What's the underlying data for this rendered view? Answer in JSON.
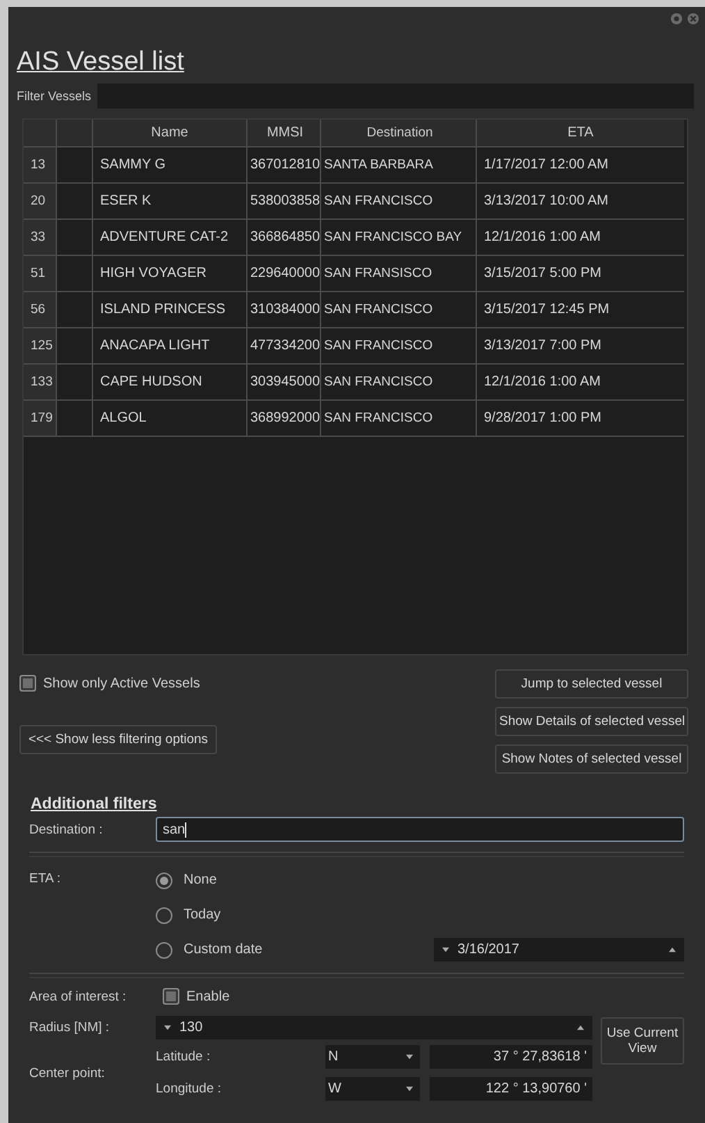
{
  "window": {
    "title": "AIS Vessel list"
  },
  "filter": {
    "label": "Filter Vessels"
  },
  "table": {
    "columns": [
      "Name",
      "MMSI",
      "Destination",
      "ETA"
    ],
    "rows": [
      {
        "number": "13",
        "name": "SAMMY G",
        "mmsi": "367012810",
        "destination": "SANTA BARBARA",
        "eta": "1/17/2017 12:00 AM"
      },
      {
        "number": "20",
        "name": "ESER K",
        "mmsi": "538003858",
        "destination": "SAN FRANCISCO",
        "eta": "3/13/2017 10:00 AM"
      },
      {
        "number": "33",
        "name": "ADVENTURE CAT-2",
        "mmsi": "366864850",
        "destination": "SAN FRANCISCO BAY",
        "eta": "12/1/2016 1:00 AM"
      },
      {
        "number": "51",
        "name": "HIGH VOYAGER",
        "mmsi": "229640000",
        "destination": "SAN FRANSISCO",
        "eta": "3/15/2017 5:00 PM"
      },
      {
        "number": "56",
        "name": "ISLAND PRINCESS",
        "mmsi": "310384000",
        "destination": "SAN FRANCISCO",
        "eta": "3/15/2017 12:45 PM"
      },
      {
        "number": "125",
        "name": "ANACAPA LIGHT",
        "mmsi": "477334200",
        "destination": "SAN FRANCISCO",
        "eta": "3/13/2017 7:00 PM"
      },
      {
        "number": "133",
        "name": "CAPE HUDSON",
        "mmsi": "303945000",
        "destination": "SAN FRANCISCO",
        "eta": "12/1/2016 1:00 AM"
      },
      {
        "number": "179",
        "name": "ALGOL",
        "mmsi": "368992000",
        "destination": "SAN FRANCISCO",
        "eta": "9/28/2017 1:00 PM"
      }
    ]
  },
  "active_only": {
    "label": "Show only Active Vessels",
    "checked": false
  },
  "actions": [
    "Jump to selected vessel",
    "Show Details of selected vessel",
    "Show Notes of selected vessel"
  ],
  "toggle_button": "<<< Show less filtering options",
  "additional_filters": {
    "title": "Additional filters",
    "destination": {
      "label": "Destination :",
      "value": "san"
    },
    "eta": {
      "label": "ETA :",
      "options": [
        {
          "label": "None",
          "selected": true
        },
        {
          "label": "Today",
          "selected": false
        },
        {
          "label": "Custom date",
          "selected": false
        }
      ],
      "custom_date": "3/16/2017"
    },
    "area": {
      "label": "Area of interest :",
      "enable": {
        "label": "Enable",
        "checked": false
      }
    },
    "radius": {
      "label": "Radius [NM] :",
      "value": "130"
    },
    "use_current_view": "Use Current View",
    "center": {
      "label": "Center point:",
      "latitude": {
        "label": "Latitude :",
        "hemisphere": "N",
        "value": "37 ° 27,83618 '"
      },
      "longitude": {
        "label": "Longitude :",
        "hemisphere": "W",
        "value": "122 ° 13,90760 '"
      }
    }
  }
}
